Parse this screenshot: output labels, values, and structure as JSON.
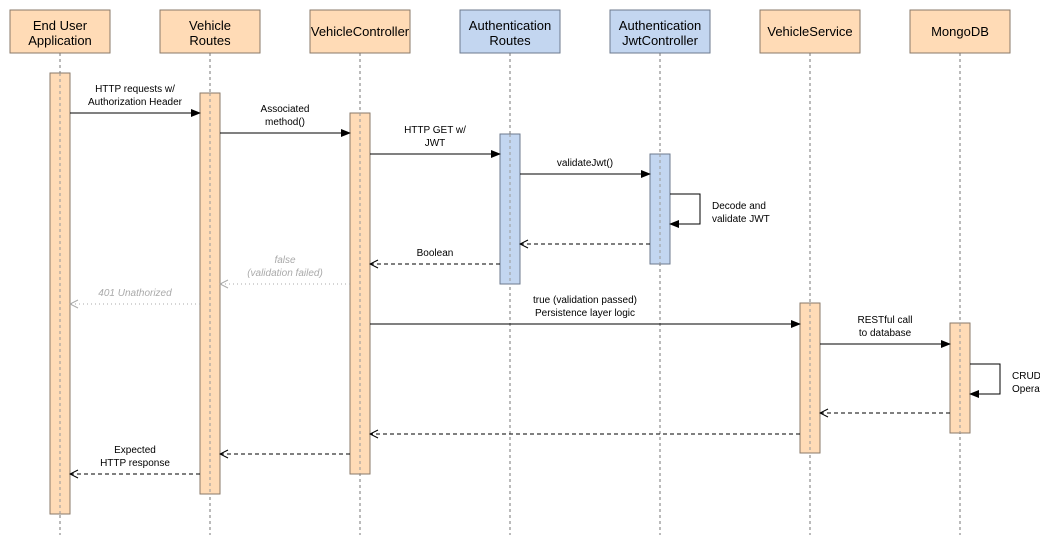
{
  "colors": {
    "orange_fill": "#ffdbb6",
    "orange_stroke": "#8a7a6a",
    "blue_fill": "#c3d6f0",
    "blue_stroke": "#6c7a8e",
    "muted": "#aaaaaa"
  },
  "participants": [
    {
      "id": "eua",
      "label": [
        "End User",
        "Application"
      ],
      "color": "orange"
    },
    {
      "id": "vr",
      "label": [
        "Vehicle",
        "Routes"
      ],
      "color": "orange"
    },
    {
      "id": "vc",
      "label": [
        "VehicleController"
      ],
      "color": "orange"
    },
    {
      "id": "ar",
      "label": [
        "Authentication",
        "Routes"
      ],
      "color": "blue"
    },
    {
      "id": "jc",
      "label": [
        "Authentication",
        "JwtController"
      ],
      "color": "blue"
    },
    {
      "id": "vs",
      "label": [
        "VehicleService"
      ],
      "color": "orange"
    },
    {
      "id": "db",
      "label": [
        "MongoDB"
      ],
      "color": "orange"
    }
  ],
  "messages": [
    {
      "from": "eua",
      "to": "vr",
      "style": "solid",
      "label": [
        "HTTP requests w/",
        "Authorization Header"
      ]
    },
    {
      "from": "vr",
      "to": "vc",
      "style": "solid",
      "label": [
        "Associated",
        "method()"
      ]
    },
    {
      "from": "vc",
      "to": "ar",
      "style": "solid",
      "label": [
        "HTTP GET w/",
        "JWT"
      ]
    },
    {
      "from": "ar",
      "to": "jc",
      "style": "solid",
      "label": [
        "validateJwt()"
      ]
    },
    {
      "from": "jc",
      "to": "jc",
      "style": "self",
      "label": [
        "Decode and",
        "validate JWT"
      ]
    },
    {
      "from": "jc",
      "to": "ar",
      "style": "dashed",
      "label": []
    },
    {
      "from": "ar",
      "to": "vc",
      "style": "dashed",
      "label": [
        "Boolean"
      ]
    },
    {
      "from": "vc",
      "to": "vr",
      "style": "dotted",
      "label": [
        "false",
        "(validation failed)"
      ]
    },
    {
      "from": "vr",
      "to": "eua",
      "style": "dotted",
      "label": [
        "401 Unathorized"
      ]
    },
    {
      "from": "vc",
      "to": "vs",
      "style": "solid",
      "label": [
        "true (validation passed)",
        "Persistence layer logic"
      ]
    },
    {
      "from": "vs",
      "to": "db",
      "style": "solid",
      "label": [
        "RESTful call",
        "to database"
      ]
    },
    {
      "from": "db",
      "to": "db",
      "style": "self",
      "label": [
        "CRUD",
        "Operation"
      ]
    },
    {
      "from": "db",
      "to": "vs",
      "style": "dashed",
      "label": []
    },
    {
      "from": "vs",
      "to": "vc",
      "style": "dashed",
      "label": []
    },
    {
      "from": "vc",
      "to": "vr",
      "style": "dashed",
      "label": []
    },
    {
      "from": "vr",
      "to": "eua",
      "style": "dashed",
      "label": [
        "Expected",
        "HTTP response"
      ]
    }
  ]
}
